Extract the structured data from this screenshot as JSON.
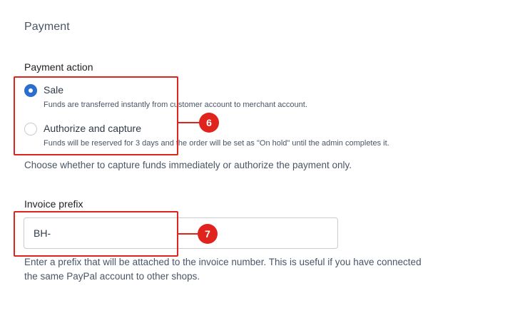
{
  "section": {
    "title": "Payment"
  },
  "payment_action": {
    "label": "Payment action",
    "options": [
      {
        "label": "Sale",
        "help": "Funds are transferred instantly from customer account to merchant account.",
        "selected": true
      },
      {
        "label": "Authorize and capture",
        "help": "Funds will be reserved for 3 days and the order will be set as \"On hold\" until the admin completes it.",
        "selected": false
      }
    ],
    "help": "Choose whether to capture funds immediately or authorize the payment only."
  },
  "invoice_prefix": {
    "label": "Invoice prefix",
    "value": "BH-",
    "help_line1": "Enter a prefix that will be attached to the invoice number. This is useful if you have connected",
    "help_line2": "the same PayPal account to other shops."
  },
  "annotations": {
    "marker_1": "6",
    "marker_2": "7"
  },
  "colors": {
    "accent": "#2c6ecb",
    "annotation": "#e0231d",
    "muted_text": "#4a5565"
  }
}
